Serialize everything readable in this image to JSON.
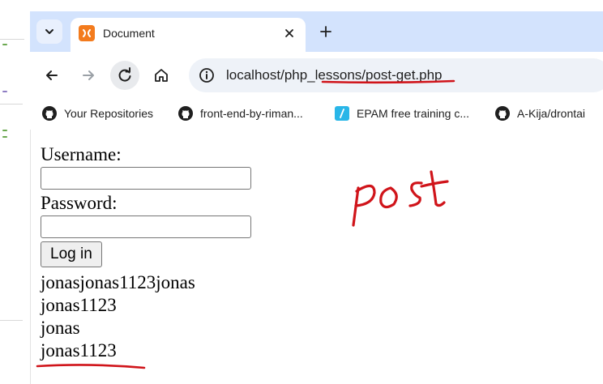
{
  "browser": {
    "tab": {
      "title": "Document"
    },
    "url": "localhost/php_lessons/post-get.php",
    "bookmarks": [
      {
        "label": "Your Repositories",
        "icon": "github-icon"
      },
      {
        "label": "front-end-by-riman...",
        "icon": "github-icon"
      },
      {
        "label": "EPAM free training c...",
        "icon": "epam-icon"
      },
      {
        "label": "A-Kija/drontai",
        "icon": "github-icon"
      }
    ]
  },
  "form": {
    "username_label": "Username:",
    "username_value": "",
    "password_label": "Password:",
    "password_value": "",
    "submit_label": "Log in"
  },
  "output": {
    "lines": [
      "jonasjonas1123jonas",
      "jonas1123",
      "jonas",
      "jonas1123"
    ]
  },
  "annotation": {
    "handwritten_text": "post",
    "ink_color": "#d0141a"
  },
  "colors": {
    "tabbar": "#d3e3fd",
    "omnibox": "#eef2f8",
    "favicon": "#f37b1d",
    "epam": "#29b6e8"
  }
}
